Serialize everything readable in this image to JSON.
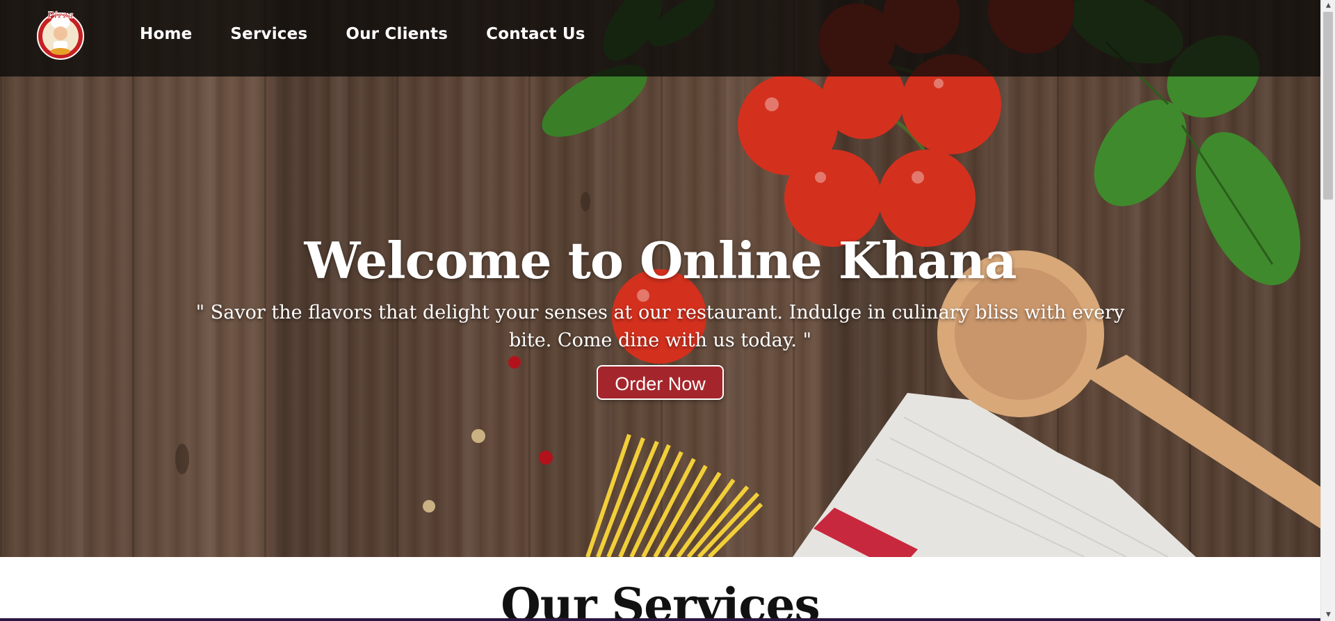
{
  "nav": {
    "logo_alt": "Pizza chef logo",
    "items": [
      {
        "label": "Home"
      },
      {
        "label": "Services"
      },
      {
        "label": "Our Clients"
      },
      {
        "label": "Contact Us"
      }
    ]
  },
  "hero": {
    "title": "Welcome to Online Khana",
    "tagline": "\" Savor the flavors that delight your senses at our restaurant. Indulge in culinary bliss with every bite. Come dine with us today. \"",
    "cta_label": "Order Now",
    "cta_color": "#a4262c"
  },
  "services": {
    "heading": "Our Services"
  },
  "icons": {
    "scroll_up": "scroll-up-arrow-icon",
    "scroll_down": "scroll-down-arrow-icon"
  }
}
